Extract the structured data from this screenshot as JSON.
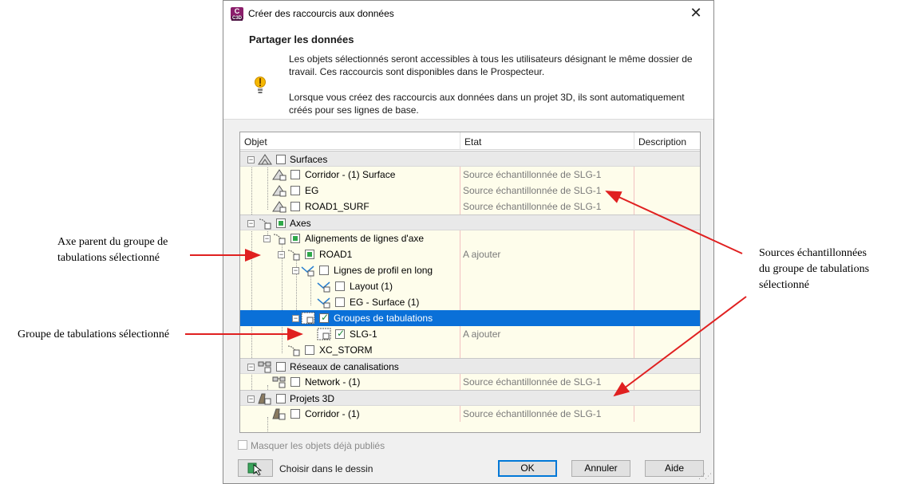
{
  "annotations": {
    "left1_line1": "Axe parent du groupe de",
    "left1_line2": "tabulations sélectionné",
    "left2": "Groupe de tabulations sélectionné",
    "right_line1": "Sources échantillonnées",
    "right_line2": "du groupe de tabulations",
    "right_line3": "sélectionné"
  },
  "dialog": {
    "title": "Créer des raccourcis aux données",
    "app_icon_letter": "C",
    "app_icon_sub": "C3D",
    "close_glyph": "✕",
    "section_title": "Partager les données",
    "info_p1": "Les objets sélectionnés seront accessibles à tous les utilisateurs désignant le même dossier de travail. Ces raccourcis sont disponibles dans le Prospecteur.",
    "info_p2": "Lorsque vous créez des raccourcis aux données dans un projet 3D, ils sont automatiquement créés pour ses lignes de base."
  },
  "tree": {
    "columns": {
      "object": "Objet",
      "state": "Etat",
      "description": "Description"
    },
    "rows": [
      {
        "label": "Surfaces",
        "state": ""
      },
      {
        "label": "Corridor - (1) Surface",
        "state": "Source échantillonnée de SLG-1"
      },
      {
        "label": "EG",
        "state": "Source échantillonnée de SLG-1"
      },
      {
        "label": "ROAD1_SURF",
        "state": "Source échantillonnée de SLG-1"
      },
      {
        "label": "Axes",
        "state": ""
      },
      {
        "label": "Alignements de lignes d'axe",
        "state": ""
      },
      {
        "label": "ROAD1",
        "state": "A ajouter"
      },
      {
        "label": "Lignes de profil en long",
        "state": ""
      },
      {
        "label": "Layout (1)",
        "state": ""
      },
      {
        "label": "EG - Surface (1)",
        "state": ""
      },
      {
        "label": "Groupes de tabulations",
        "state": ""
      },
      {
        "label": "SLG-1",
        "state": "A ajouter"
      },
      {
        "label": "XC_STORM",
        "state": ""
      },
      {
        "label": "Réseaux de canalisations",
        "state": ""
      },
      {
        "label": "Network - (1)",
        "state": "Source échantillonnée de SLG-1"
      },
      {
        "label": "Projets 3D",
        "state": ""
      },
      {
        "label": "Corridor - (1)",
        "state": "Source échantillonnée de SLG-1"
      }
    ]
  },
  "footer": {
    "hide_published": "Masquer les objets déjà publiés",
    "pick_from_drawing": "Choisir dans le dessin",
    "ok": "OK",
    "cancel": "Annuler",
    "help": "Aide"
  },
  "colors": {
    "selection": "#0a70d8",
    "tree_background": "#fefdeb",
    "arrow": "#e02020"
  }
}
